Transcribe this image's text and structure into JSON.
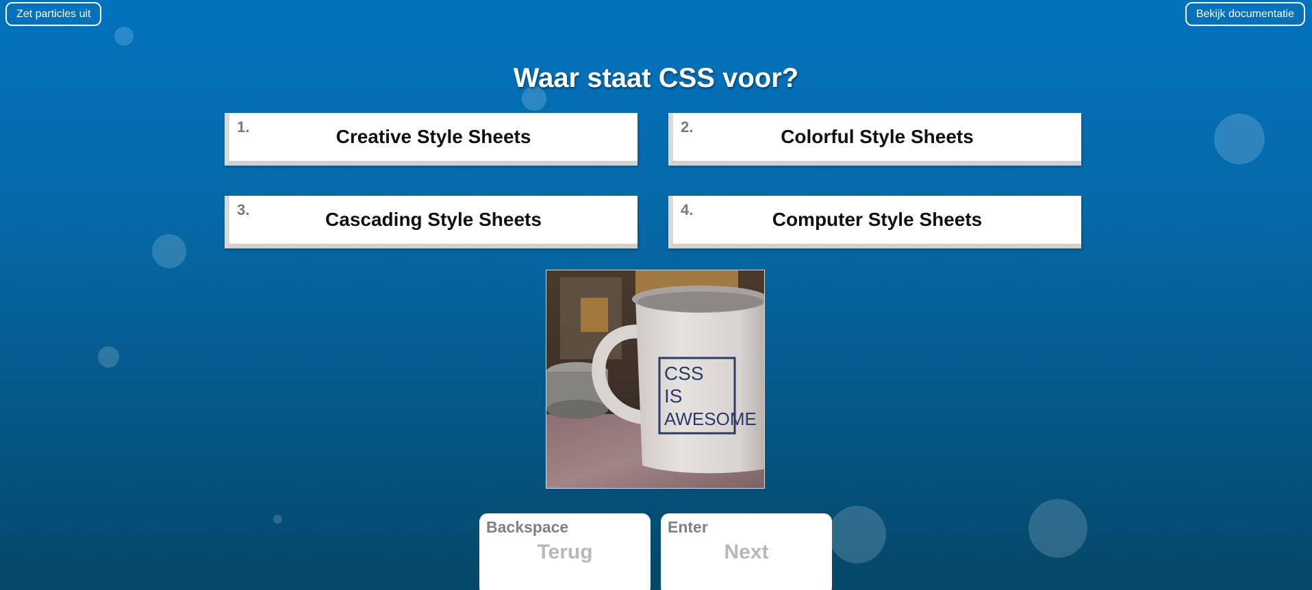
{
  "top_bar": {
    "particles_toggle_label": "Zet particles uit",
    "docs_label": "Bekijk documentatie"
  },
  "quiz": {
    "question": "Waar staat CSS voor?",
    "answers": [
      {
        "number": "1.",
        "label": "Creative Style Sheets"
      },
      {
        "number": "2.",
        "label": "Colorful Style Sheets"
      },
      {
        "number": "3.",
        "label": "Cascading Style Sheets"
      },
      {
        "number": "4.",
        "label": "Computer Style Sheets"
      }
    ],
    "image": {
      "icon": "mug-photo",
      "mug_text": [
        "CSS",
        "IS",
        "AWESOME"
      ]
    }
  },
  "navigation": {
    "back": {
      "key": "Backspace",
      "label": "Terug"
    },
    "next": {
      "key": "Enter",
      "label": "Next"
    }
  },
  "colors": {
    "background_top": "#0272be",
    "background_bottom": "#044768",
    "answer_number": "#7a7a7a",
    "nav_label": "#b8b8b8"
  }
}
